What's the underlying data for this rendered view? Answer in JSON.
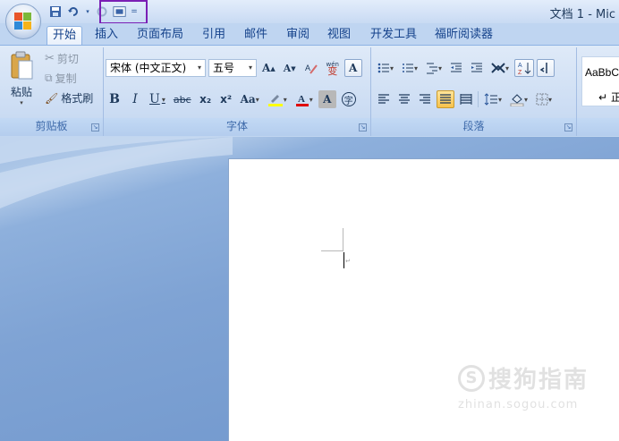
{
  "title_bar": {
    "document_title": "文档 1 - Mic",
    "qat_items": [
      "save-icon",
      "undo-icon",
      "undo-dropdown-icon",
      "redo-icon",
      "print-preview-icon",
      "customize-qat-icon"
    ]
  },
  "tabs": [
    {
      "label": "开始",
      "active": true
    },
    {
      "label": "插入"
    },
    {
      "label": "页面布局"
    },
    {
      "label": "引用"
    },
    {
      "label": "邮件"
    },
    {
      "label": "审阅"
    },
    {
      "label": "视图"
    },
    {
      "label": "开发工具"
    },
    {
      "label": "福昕阅读器"
    }
  ],
  "clipboard": {
    "label": "剪贴板",
    "paste": "粘贴",
    "cut": "剪切",
    "copy": "复制",
    "format_painter": "格式刷"
  },
  "font": {
    "label": "字体",
    "font_name": "宋体 (中文正文)",
    "font_size": "五号",
    "bold": "B",
    "italic": "I",
    "underline": "U",
    "strikethrough": "abc",
    "subscript": "x₂",
    "superscript": "x²",
    "change_case": "Aa",
    "grow": "A",
    "shrink": "A",
    "phonetic": "wén",
    "phonetic_char": "变",
    "border_char": "A",
    "shade_char": "A",
    "enclose_char": "字"
  },
  "paragraph": {
    "label": "段落"
  },
  "styles": {
    "sample": "AaBbC",
    "normal": "↵ 正"
  },
  "watermark": {
    "title": "搜狗指南",
    "url": "zhinan.sogou.com"
  },
  "colors": {
    "highlight_box": "#7a1fb5",
    "font_color": "#e00000",
    "highlight_color": "#ffff00"
  }
}
